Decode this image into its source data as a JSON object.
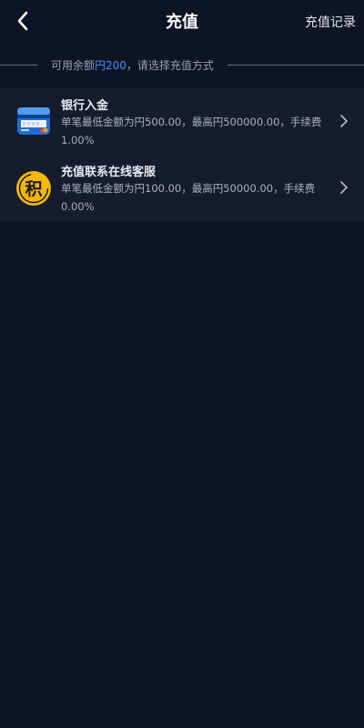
{
  "header": {
    "back_icon": "chevron-left-icon",
    "title": "充值",
    "records_link": "充值记录"
  },
  "balance": {
    "prefix": "可用余额",
    "amount": "円200",
    "suffix": "，请选择充值方式"
  },
  "methods": [
    {
      "icon": "bank-card-icon",
      "name": "银行入金",
      "description": "单笔最低金额为円500.00，最高円500000.00，手续费1.00%"
    },
    {
      "icon": "points-ji-icon",
      "icon_text": "积",
      "name": "充值联系在线客服",
      "description": "单笔最低金额为円100.00，最高円50000.00，手续费0.00%"
    }
  ],
  "colors": {
    "background": "#0e1424",
    "card_background": "#141c2d",
    "accent_blue": "#4a8cff",
    "points_yellow": "#f5b800"
  }
}
